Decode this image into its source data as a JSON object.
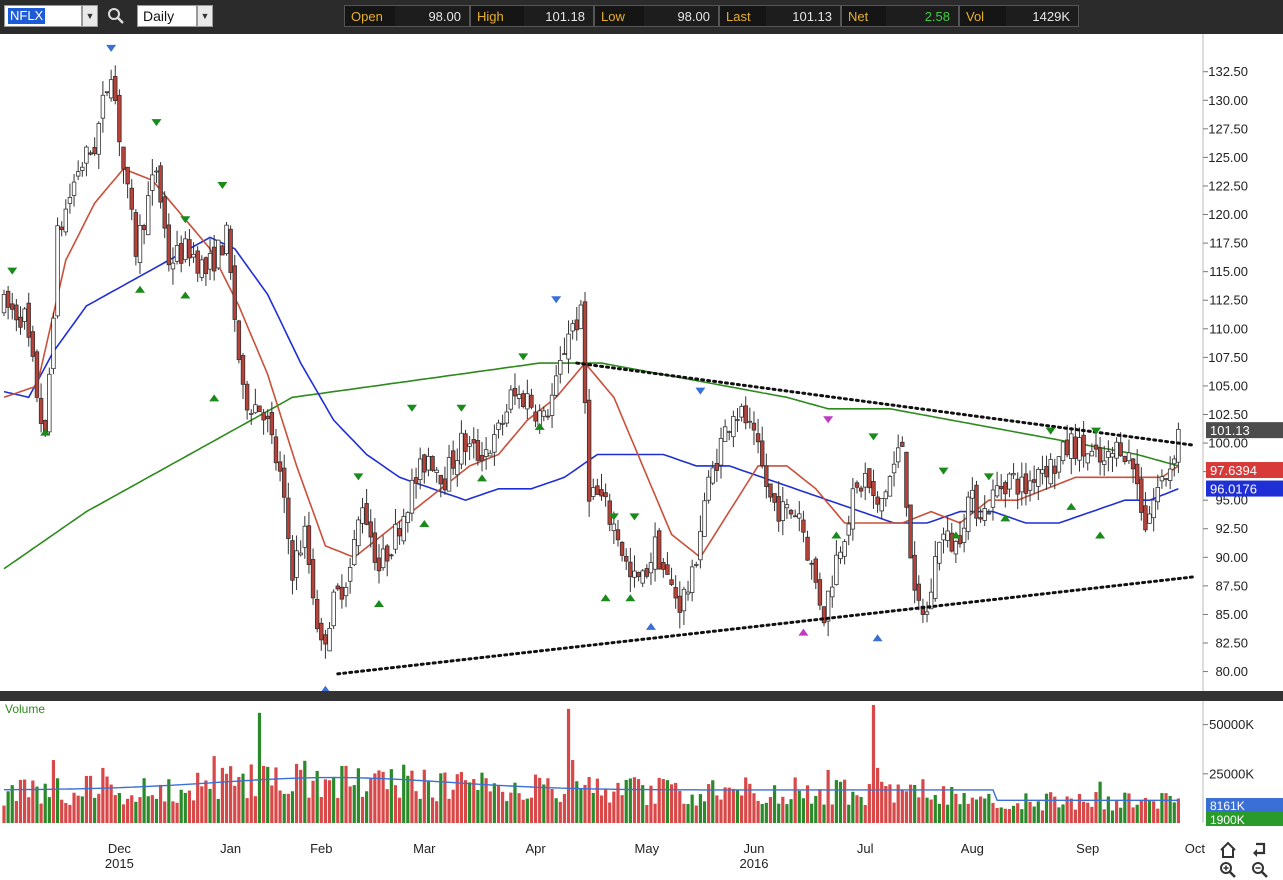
{
  "toolbar": {
    "symbol": "NFLX",
    "period": "Daily",
    "quote": [
      {
        "label": "Open",
        "value": "98.00",
        "kind": "plain"
      },
      {
        "label": "High",
        "value": "101.18",
        "kind": "plain"
      },
      {
        "label": "Low",
        "value": "98.00",
        "kind": "plain"
      },
      {
        "label": "Last",
        "value": "101.13",
        "kind": "plain"
      },
      {
        "label": "Net",
        "value": "2.58",
        "kind": "net"
      },
      {
        "label": "Vol",
        "value": "1429K",
        "kind": "plain"
      }
    ]
  },
  "chart_data": {
    "type": "candlestick",
    "y_ticks": [
      "132.50",
      "130.00",
      "127.50",
      "125.00",
      "122.50",
      "120.00",
      "117.50",
      "115.00",
      "112.50",
      "110.00",
      "107.50",
      "105.00",
      "102.50",
      "100.00",
      "97.50",
      "95.00",
      "92.50",
      "90.00",
      "87.50",
      "85.00",
      "82.50",
      "80.00"
    ],
    "ylim": [
      78.3,
      135.8
    ],
    "x_labels": [
      {
        "text": "Dec",
        "sub": "2015",
        "day": 28
      },
      {
        "text": "Jan",
        "sub": "",
        "day": 55
      },
      {
        "text": "Feb",
        "sub": "",
        "day": 77
      },
      {
        "text": "Mar",
        "sub": "",
        "day": 102
      },
      {
        "text": "Apr",
        "sub": "",
        "day": 129
      },
      {
        "text": "May",
        "sub": "",
        "day": 156
      },
      {
        "text": "Jun",
        "sub": "2016",
        "day": 182
      },
      {
        "text": "Jul",
        "sub": "",
        "day": 209
      },
      {
        "text": "Aug",
        "sub": "",
        "day": 235
      },
      {
        "text": "Sep",
        "sub": "",
        "day": 263
      },
      {
        "text": "Oct",
        "sub": "",
        "day": 289
      }
    ],
    "price_waypoints": [
      [
        0,
        112
      ],
      [
        5,
        111
      ],
      [
        10,
        100
      ],
      [
        13,
        118
      ],
      [
        18,
        124
      ],
      [
        22,
        126
      ],
      [
        26,
        133
      ],
      [
        29,
        124
      ],
      [
        32,
        117
      ],
      [
        37,
        124
      ],
      [
        40,
        116
      ],
      [
        45,
        117
      ],
      [
        49,
        115
      ],
      [
        54,
        118
      ],
      [
        58,
        104
      ],
      [
        63,
        103
      ],
      [
        67,
        97
      ],
      [
        70,
        89
      ],
      [
        73,
        92
      ],
      [
        77,
        82
      ],
      [
        80,
        86
      ],
      [
        84,
        89
      ],
      [
        87,
        95
      ],
      [
        91,
        89
      ],
      [
        95,
        92
      ],
      [
        99,
        96
      ],
      [
        103,
        99
      ],
      [
        107,
        97
      ],
      [
        111,
        100
      ],
      [
        115,
        99
      ],
      [
        119,
        100
      ],
      [
        123,
        104
      ],
      [
        127,
        104
      ],
      [
        131,
        102
      ],
      [
        134,
        105
      ],
      [
        137,
        110
      ],
      [
        140,
        111
      ],
      [
        142,
        96
      ],
      [
        145,
        95
      ],
      [
        149,
        92
      ],
      [
        152,
        88
      ],
      [
        155,
        88
      ],
      [
        158,
        91
      ],
      [
        161,
        88
      ],
      [
        164,
        86
      ],
      [
        167,
        88
      ],
      [
        170,
        95
      ],
      [
        174,
        100
      ],
      [
        177,
        103
      ],
      [
        180,
        102
      ],
      [
        183,
        99
      ],
      [
        186,
        95
      ],
      [
        189,
        94
      ],
      [
        193,
        94
      ],
      [
        196,
        89
      ],
      [
        199,
        85
      ],
      [
        202,
        90
      ],
      [
        206,
        95
      ],
      [
        209,
        97
      ],
      [
        212,
        94
      ],
      [
        215,
        97
      ],
      [
        218,
        100
      ],
      [
        221,
        86
      ],
      [
        224,
        85
      ],
      [
        227,
        92
      ],
      [
        231,
        91
      ],
      [
        234,
        95
      ],
      [
        238,
        94
      ],
      [
        241,
        96
      ],
      [
        244,
        97
      ],
      [
        248,
        96
      ],
      [
        251,
        98
      ],
      [
        255,
        98
      ],
      [
        259,
        100
      ],
      [
        263,
        99
      ],
      [
        267,
        98
      ],
      [
        271,
        100
      ],
      [
        274,
        98
      ],
      [
        277,
        93
      ],
      [
        280,
        96
      ],
      [
        283,
        98
      ],
      [
        285,
        101
      ]
    ],
    "ma_short_waypoints": [
      [
        0,
        104
      ],
      [
        8,
        105
      ],
      [
        15,
        116
      ],
      [
        22,
        121
      ],
      [
        29,
        124
      ],
      [
        36,
        123
      ],
      [
        43,
        120
      ],
      [
        50,
        117
      ],
      [
        57,
        112
      ],
      [
        64,
        106
      ],
      [
        71,
        98
      ],
      [
        78,
        91
      ],
      [
        85,
        90
      ],
      [
        92,
        92
      ],
      [
        99,
        94
      ],
      [
        106,
        96
      ],
      [
        113,
        98
      ],
      [
        120,
        99
      ],
      [
        127,
        102
      ],
      [
        134,
        104
      ],
      [
        141,
        107
      ],
      [
        148,
        104
      ],
      [
        155,
        98
      ],
      [
        162,
        92
      ],
      [
        169,
        90
      ],
      [
        176,
        94
      ],
      [
        183,
        98
      ],
      [
        190,
        98
      ],
      [
        197,
        96
      ],
      [
        204,
        93
      ],
      [
        211,
        93
      ],
      [
        218,
        93
      ],
      [
        225,
        94
      ],
      [
        232,
        93
      ],
      [
        239,
        95
      ],
      [
        246,
        95
      ],
      [
        253,
        96
      ],
      [
        260,
        97
      ],
      [
        267,
        97
      ],
      [
        274,
        97
      ],
      [
        281,
        97
      ],
      [
        285,
        98
      ]
    ],
    "ma_mid_waypoints": [
      [
        0,
        104.5
      ],
      [
        6,
        104
      ],
      [
        12,
        108
      ],
      [
        20,
        112
      ],
      [
        30,
        114
      ],
      [
        40,
        116
      ],
      [
        50,
        118
      ],
      [
        56,
        117
      ],
      [
        64,
        113
      ],
      [
        72,
        107
      ],
      [
        80,
        102
      ],
      [
        88,
        99
      ],
      [
        96,
        97
      ],
      [
        104,
        96
      ],
      [
        112,
        95
      ],
      [
        120,
        96
      ],
      [
        128,
        96
      ],
      [
        136,
        97
      ],
      [
        144,
        99
      ],
      [
        152,
        99
      ],
      [
        160,
        99
      ],
      [
        168,
        98
      ],
      [
        176,
        98
      ],
      [
        184,
        97
      ],
      [
        192,
        96
      ],
      [
        200,
        95
      ],
      [
        208,
        94
      ],
      [
        216,
        93
      ],
      [
        224,
        93
      ],
      [
        232,
        94
      ],
      [
        240,
        94
      ],
      [
        248,
        93
      ],
      [
        256,
        93
      ],
      [
        264,
        94
      ],
      [
        272,
        95
      ],
      [
        278,
        95
      ],
      [
        285,
        96
      ]
    ],
    "ma_long_waypoints": [
      [
        0,
        89
      ],
      [
        20,
        94
      ],
      [
        40,
        98
      ],
      [
        60,
        102
      ],
      [
        70,
        104
      ],
      [
        90,
        105
      ],
      [
        110,
        106
      ],
      [
        130,
        107
      ],
      [
        145,
        107
      ],
      [
        160,
        106
      ],
      [
        175,
        105
      ],
      [
        190,
        104
      ],
      [
        200,
        103
      ],
      [
        215,
        103
      ],
      [
        230,
        102
      ],
      [
        245,
        101
      ],
      [
        260,
        100
      ],
      [
        275,
        99
      ],
      [
        285,
        98
      ]
    ],
    "trendlines": [
      {
        "from": [
          81,
          79.8
        ],
        "to": [
          289,
          88.3
        ],
        "style": "dotted"
      },
      {
        "from": [
          139,
          107
        ],
        "to": [
          289,
          99.8
        ],
        "style": "dotted"
      }
    ],
    "last_price": "101.13",
    "price_tags": [
      {
        "value": "101.13",
        "color": "#4d4d4d"
      },
      {
        "value": "97.6394",
        "color": "#d83a3a"
      },
      {
        "value": "96.0176",
        "color": "#1f2fd6"
      }
    ],
    "markers": [
      {
        "day": 26,
        "price": 134.5,
        "dir": "down",
        "color": "#3a6fd6"
      },
      {
        "day": 37,
        "price": 128,
        "dir": "down",
        "color": "#1a8a1a"
      },
      {
        "day": 44,
        "price": 119.5,
        "dir": "down",
        "color": "#1a8a1a"
      },
      {
        "day": 53,
        "price": 122.5,
        "dir": "down",
        "color": "#1a8a1a"
      },
      {
        "day": 2,
        "price": 115,
        "dir": "down",
        "color": "#1a8a1a"
      },
      {
        "day": 99,
        "price": 103,
        "dir": "down",
        "color": "#1a8a1a"
      },
      {
        "day": 86,
        "price": 97,
        "dir": "down",
        "color": "#1a8a1a"
      },
      {
        "day": 111,
        "price": 103,
        "dir": "down",
        "color": "#1a8a1a"
      },
      {
        "day": 126,
        "price": 107.5,
        "dir": "down",
        "color": "#1a8a1a"
      },
      {
        "day": 134,
        "price": 112.5,
        "dir": "down",
        "color": "#3a6fd6"
      },
      {
        "day": 148,
        "price": 93.5,
        "dir": "down",
        "color": "#1a8a1a"
      },
      {
        "day": 153,
        "price": 93.5,
        "dir": "down",
        "color": "#1a8a1a"
      },
      {
        "day": 169,
        "price": 104.5,
        "dir": "down",
        "color": "#3a6fd6"
      },
      {
        "day": 200,
        "price": 102,
        "dir": "down",
        "color": "#c03ac0"
      },
      {
        "day": 211,
        "price": 100.5,
        "dir": "down",
        "color": "#1a8a1a"
      },
      {
        "day": 228,
        "price": 97.5,
        "dir": "down",
        "color": "#1a8a1a"
      },
      {
        "day": 239,
        "price": 97,
        "dir": "down",
        "color": "#1a8a1a"
      },
      {
        "day": 254,
        "price": 101,
        "dir": "down",
        "color": "#1a8a1a"
      },
      {
        "day": 265,
        "price": 101,
        "dir": "down",
        "color": "#1a8a1a"
      },
      {
        "day": 10,
        "price": 101,
        "dir": "up",
        "color": "#1a8a1a"
      },
      {
        "day": 33,
        "price": 113.5,
        "dir": "up",
        "color": "#1a8a1a"
      },
      {
        "day": 44,
        "price": 113,
        "dir": "up",
        "color": "#1a8a1a"
      },
      {
        "day": 51,
        "price": 104,
        "dir": "up",
        "color": "#1a8a1a"
      },
      {
        "day": 78,
        "price": 78.5,
        "dir": "up",
        "color": "#3a6fd6"
      },
      {
        "day": 91,
        "price": 86,
        "dir": "up",
        "color": "#1a8a1a"
      },
      {
        "day": 102,
        "price": 93,
        "dir": "up",
        "color": "#1a8a1a"
      },
      {
        "day": 116,
        "price": 97,
        "dir": "up",
        "color": "#1a8a1a"
      },
      {
        "day": 130,
        "price": 101.5,
        "dir": "up",
        "color": "#1a8a1a"
      },
      {
        "day": 146,
        "price": 86.5,
        "dir": "up",
        "color": "#1a8a1a"
      },
      {
        "day": 152,
        "price": 86.5,
        "dir": "up",
        "color": "#1a8a1a"
      },
      {
        "day": 157,
        "price": 84,
        "dir": "up",
        "color": "#3a6fd6"
      },
      {
        "day": 194,
        "price": 83.5,
        "dir": "up",
        "color": "#c03ac0"
      },
      {
        "day": 202,
        "price": 92,
        "dir": "up",
        "color": "#1a8a1a"
      },
      {
        "day": 212,
        "price": 83,
        "dir": "up",
        "color": "#3a6fd6"
      },
      {
        "day": 231,
        "price": 92,
        "dir": "up",
        "color": "#1a8a1a"
      },
      {
        "day": 243,
        "price": 93.5,
        "dir": "up",
        "color": "#1a8a1a"
      },
      {
        "day": 259,
        "price": 94.5,
        "dir": "up",
        "color": "#1a8a1a"
      },
      {
        "day": 266,
        "price": 92,
        "dir": "up",
        "color": "#1a8a1a"
      }
    ],
    "volume": {
      "label": "Volume",
      "ticks": [
        "50000K",
        "25000K"
      ],
      "ymax": 62000,
      "tags": [
        {
          "value": "8161K",
          "color": "#3a6fd6"
        },
        {
          "value": "1900K",
          "color": "#2a9a2a"
        }
      ],
      "spikes": [
        [
          12,
          32000
        ],
        [
          24,
          28000
        ],
        [
          51,
          34000
        ],
        [
          62,
          56000
        ],
        [
          63,
          29000
        ],
        [
          72,
          27000
        ],
        [
          98,
          24000
        ],
        [
          137,
          58000
        ],
        [
          138,
          32000
        ],
        [
          211,
          60000
        ],
        [
          212,
          28000
        ],
        [
          200,
          27000
        ],
        [
          266,
          21000
        ]
      ],
      "baseline": 16000
    }
  },
  "nav": {
    "home": "home-icon",
    "back": "undo-icon",
    "zoom_in": "zoom-in-icon",
    "zoom_out": "zoom-out-icon"
  }
}
